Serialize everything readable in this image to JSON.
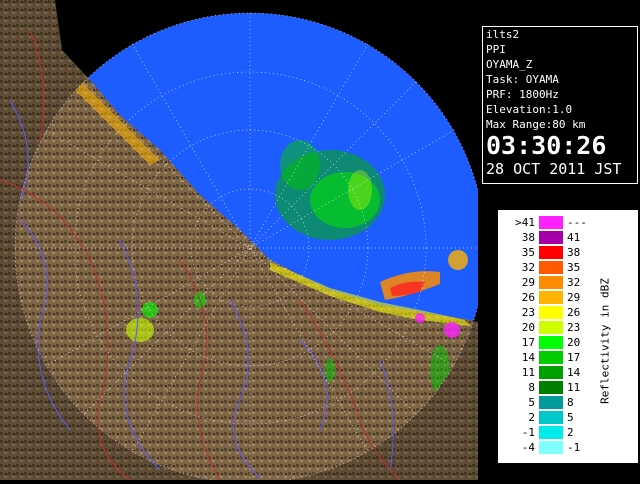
{
  "radar": {
    "site": "ilts2",
    "product": "PPI",
    "field": "OYAMA_Z",
    "task": "Task: OYAMA",
    "prf": "PRF: 1800Hz",
    "elevation": "Elevation:1.0",
    "max_range": "Max Range:80 km",
    "time": "03:30:26",
    "date": "28 OCT 2011 JST"
  },
  "legend": {
    "unit": "Reflectivity in dBZ",
    "bins": [
      {
        "low": ">41",
        "high": "---",
        "color": "#ff22ff"
      },
      {
        "low": "38",
        "high": "41",
        "color": "#a800a8"
      },
      {
        "low": "35",
        "high": "38",
        "color": "#ff0000"
      },
      {
        "low": "32",
        "high": "35",
        "color": "#ff5a00"
      },
      {
        "low": "29",
        "high": "32",
        "color": "#ff8c00"
      },
      {
        "low": "26",
        "high": "29",
        "color": "#ffb400"
      },
      {
        "low": "23",
        "high": "26",
        "color": "#ffff00"
      },
      {
        "low": "20",
        "high": "23",
        "color": "#ccff00"
      },
      {
        "low": "17",
        "high": "20",
        "color": "#00ff00"
      },
      {
        "low": "14",
        "high": "17",
        "color": "#00cc00"
      },
      {
        "low": "11",
        "high": "14",
        "color": "#00a000"
      },
      {
        "low": "8",
        "high": "11",
        "color": "#008000"
      },
      {
        "low": "5",
        "high": "8",
        "color": "#009a9a"
      },
      {
        "low": "2",
        "high": "5",
        "color": "#00c8c8"
      },
      {
        "low": "-1",
        "high": "2",
        "color": "#00ecec"
      },
      {
        "low": "-4",
        "high": "-1",
        "color": "#80ffff"
      }
    ]
  },
  "colors": {
    "sea_in_range": "#1d5cff",
    "sea_out_range": "#000000",
    "land": "#7a6348",
    "rivers": "#5a5aff",
    "boundaries": "#c03030"
  }
}
